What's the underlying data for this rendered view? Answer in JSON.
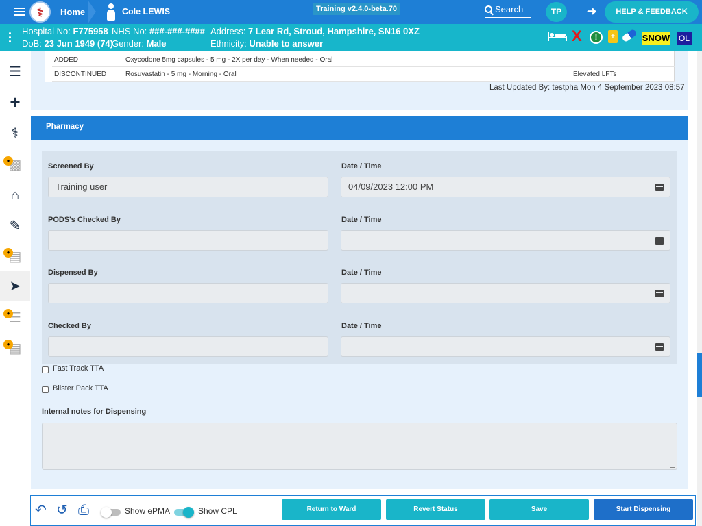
{
  "header": {
    "home_label": "Home",
    "patient_name": "Cole LEWIS",
    "version": "Training v2.4.0-beta.70",
    "search_label": "Search",
    "user_initials": "TP",
    "help_label": "HELP & FEEDBACK"
  },
  "patient": {
    "hospital_no_label": "Hospital No:",
    "hospital_no": "F775958",
    "nhs_no_label": "NHS No:",
    "nhs_no": "###-###-####",
    "address_label": "Address:",
    "address": "7 Lear Rd, Stroud, Hampshire, SN16 0XZ",
    "dob_label": "DoB:",
    "dob": "23 Jun 1949 (74)",
    "gender_label": "Gender:",
    "gender": "Male",
    "ethnicity_label": "Ethnicity:",
    "ethnicity": "Unable to answer",
    "alert_x": "X",
    "alert_excl": "!",
    "alert_plus": "+",
    "snow_label": "SNOW",
    "ol_label": "OL"
  },
  "med_changes": [
    {
      "status": "ADDED",
      "drug": "Oxycodone 5mg capsules - 5 mg - 2X per day - When needed - Oral",
      "reason": ""
    },
    {
      "status": "DISCONTINUED",
      "drug": "Rosuvastatin - 5 mg - Morning - Oral",
      "reason": "Elevated LFTs"
    }
  ],
  "last_updated": "Last Updated By: testpha Mon 4 September 2023 08:57",
  "pharmacy": {
    "title": "Pharmacy",
    "screened_by_label": "Screened By",
    "screened_by_value": "Training user",
    "datetime_label": "Date / Time",
    "screened_datetime": "04/09/2023 12:00 PM",
    "pods_label": "PODS's Checked By",
    "dispensed_label": "Dispensed By",
    "checked_label": "Checked By",
    "fast_track_label": "Fast Track TTA",
    "blister_label": "Blister Pack TTA",
    "notes_label": "Internal notes for Dispensing"
  },
  "footer": {
    "show_epma_label": "Show ePMA",
    "show_epma_on": false,
    "show_cpl_label": "Show CPL",
    "show_cpl_on": true,
    "buttons": [
      "Return to Ward",
      "Revert Status",
      "Save",
      "Start Dispensing"
    ]
  },
  "colors": {
    "topbar": "#1e7fd6",
    "patient_bar": "#17b6cb",
    "accent_teal": "#19b5c9",
    "primary_button": "#1e6fc9"
  },
  "icons": [
    "menu-icon",
    "logo-icon",
    "person-icon",
    "search-icon",
    "logout-icon",
    "bed-icon",
    "pill-icon",
    "calendar-icon",
    "undo-icon",
    "history-icon",
    "print-icon"
  ]
}
